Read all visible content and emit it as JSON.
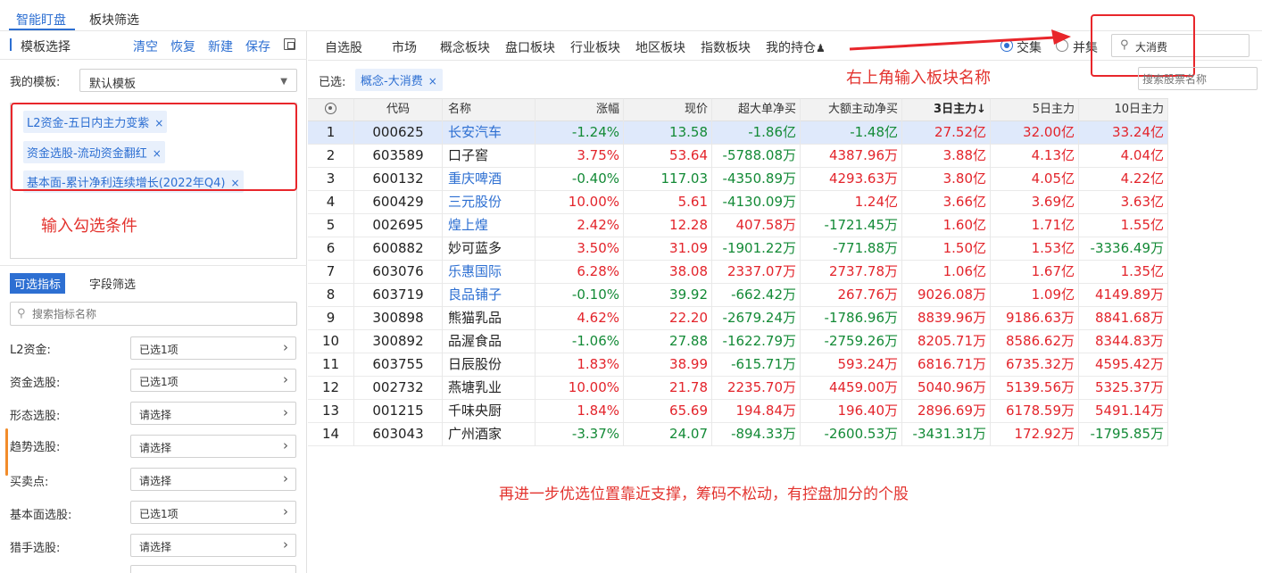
{
  "top_tabs": [
    {
      "label": "智能盯盘",
      "active": true
    },
    {
      "label": "板块筛选",
      "active": false
    }
  ],
  "template": {
    "title": "模板选择",
    "actions": [
      "清空",
      "恢复",
      "新建",
      "保存"
    ],
    "my_template_label": "我的模板:",
    "my_template_value": "默认模板"
  },
  "conditions": [
    "L2资金-五日内主力变紫",
    "资金选股-流动资金翻红",
    "基本面-累计净利连续增长(2022年Q4)"
  ],
  "annotations": {
    "left": "输入勾选条件",
    "top_right": "右上角输入板块名称",
    "bottom": "再进一步优选位置靠近支撑，筹码不松动，有控盘加分的个股"
  },
  "indicator_tabs": [
    "可选指标",
    "字段筛选"
  ],
  "indicator_search_placeholder": "搜索指标名称",
  "indicator_rows": [
    {
      "label": "L2资金:",
      "value": "已选1项"
    },
    {
      "label": "资金选股:",
      "value": "已选1项"
    },
    {
      "label": "形态选股:",
      "value": "请选择"
    },
    {
      "label": "趋势选股:",
      "value": "请选择"
    },
    {
      "label": "买卖点:",
      "value": "请选择"
    },
    {
      "label": "基本面选股:",
      "value": "已选1项"
    },
    {
      "label": "猎手选股:",
      "value": "请选择"
    }
  ],
  "nav": {
    "items": [
      "自选股",
      "市场",
      "概念板块",
      "盘口板块",
      "行业板块",
      "地区板块",
      "指数板块",
      "我的持仓"
    ],
    "radio": [
      {
        "label": "交集",
        "checked": true
      },
      {
        "label": "并集",
        "checked": false
      }
    ],
    "sector_search_value": "大消费"
  },
  "selected": {
    "label": "已选:",
    "chip": "概念-大消费",
    "stock_search_placeholder": "搜索股票名称"
  },
  "table": {
    "headers": [
      "代码",
      "名称",
      "涨幅",
      "现价",
      "超大单净买",
      "大额主动净买",
      "3日主力↓",
      "5日主力",
      "10日主力"
    ],
    "rows": [
      {
        "idx": "1",
        "code": "000625",
        "name": "长安汽车",
        "name_link": true,
        "chg": "-1.24%",
        "px": "13.58",
        "sd": "-1.86亿",
        "da": "-1.48亿",
        "m3": "27.52亿",
        "m5": "32.00亿",
        "m10": "33.24亿"
      },
      {
        "idx": "2",
        "code": "603589",
        "name": "口子窖",
        "name_link": false,
        "chg": "3.75%",
        "px": "53.64",
        "sd": "-5788.08万",
        "da": "4387.96万",
        "m3": "3.88亿",
        "m5": "4.13亿",
        "m10": "4.04亿"
      },
      {
        "idx": "3",
        "code": "600132",
        "name": "重庆啤酒",
        "name_link": true,
        "chg": "-0.40%",
        "px": "117.03",
        "sd": "-4350.89万",
        "da": "4293.63万",
        "m3": "3.80亿",
        "m5": "4.05亿",
        "m10": "4.22亿"
      },
      {
        "idx": "4",
        "code": "600429",
        "name": "三元股份",
        "name_link": true,
        "chg": "10.00%",
        "px": "5.61",
        "sd": "-4130.09万",
        "da": "1.24亿",
        "m3": "3.66亿",
        "m5": "3.69亿",
        "m10": "3.63亿"
      },
      {
        "idx": "5",
        "code": "002695",
        "name": "煌上煌",
        "name_link": true,
        "chg": "2.42%",
        "px": "12.28",
        "sd": "407.58万",
        "da": "-1721.45万",
        "m3": "1.60亿",
        "m5": "1.71亿",
        "m10": "1.55亿"
      },
      {
        "idx": "6",
        "code": "600882",
        "name": "妙可蓝多",
        "name_link": false,
        "chg": "3.50%",
        "px": "31.09",
        "sd": "-1901.22万",
        "da": "-771.88万",
        "m3": "1.50亿",
        "m5": "1.53亿",
        "m10": "-3336.49万"
      },
      {
        "idx": "7",
        "code": "603076",
        "name": "乐惠国际",
        "name_link": true,
        "chg": "6.28%",
        "px": "38.08",
        "sd": "2337.07万",
        "da": "2737.78万",
        "m3": "1.06亿",
        "m5": "1.67亿",
        "m10": "1.35亿"
      },
      {
        "idx": "8",
        "code": "603719",
        "name": "良品铺子",
        "name_link": true,
        "chg": "-0.10%",
        "px": "39.92",
        "sd": "-662.42万",
        "da": "267.76万",
        "m3": "9026.08万",
        "m5": "1.09亿",
        "m10": "4149.89万"
      },
      {
        "idx": "9",
        "code": "300898",
        "name": "熊猫乳品",
        "name_link": false,
        "chg": "4.62%",
        "px": "22.20",
        "sd": "-2679.24万",
        "da": "-1786.96万",
        "m3": "8839.96万",
        "m5": "9186.63万",
        "m10": "8841.68万"
      },
      {
        "idx": "10",
        "code": "300892",
        "name": "品渥食品",
        "name_link": false,
        "chg": "-1.06%",
        "px": "27.88",
        "sd": "-1622.79万",
        "da": "-2759.26万",
        "m3": "8205.71万",
        "m5": "8586.62万",
        "m10": "8344.83万"
      },
      {
        "idx": "11",
        "code": "603755",
        "name": "日辰股份",
        "name_link": false,
        "chg": "1.83%",
        "px": "38.99",
        "sd": "-615.71万",
        "da": "593.24万",
        "m3": "6816.71万",
        "m5": "6735.32万",
        "m10": "4595.42万"
      },
      {
        "idx": "12",
        "code": "002732",
        "name": "燕塘乳业",
        "name_link": false,
        "chg": "10.00%",
        "px": "21.78",
        "sd": "2235.70万",
        "da": "4459.00万",
        "m3": "5040.96万",
        "m5": "5139.56万",
        "m10": "5325.37万"
      },
      {
        "idx": "13",
        "code": "001215",
        "name": "千味央厨",
        "name_link": false,
        "chg": "1.84%",
        "px": "65.69",
        "sd": "194.84万",
        "da": "196.40万",
        "m3": "2896.69万",
        "m5": "6178.59万",
        "m10": "5491.14万"
      },
      {
        "idx": "14",
        "code": "603043",
        "name": "广州酒家",
        "name_link": false,
        "chg": "-3.37%",
        "px": "24.07",
        "sd": "-894.33万",
        "da": "-2600.53万",
        "m3": "-3431.31万",
        "m5": "172.92万",
        "m10": "-1795.85万"
      }
    ]
  },
  "colors": {
    "accent": "#2d6fd2",
    "up": "#e3242b",
    "down": "#138a36",
    "annotation": "#e3342f",
    "orange": "#f28c2a"
  }
}
